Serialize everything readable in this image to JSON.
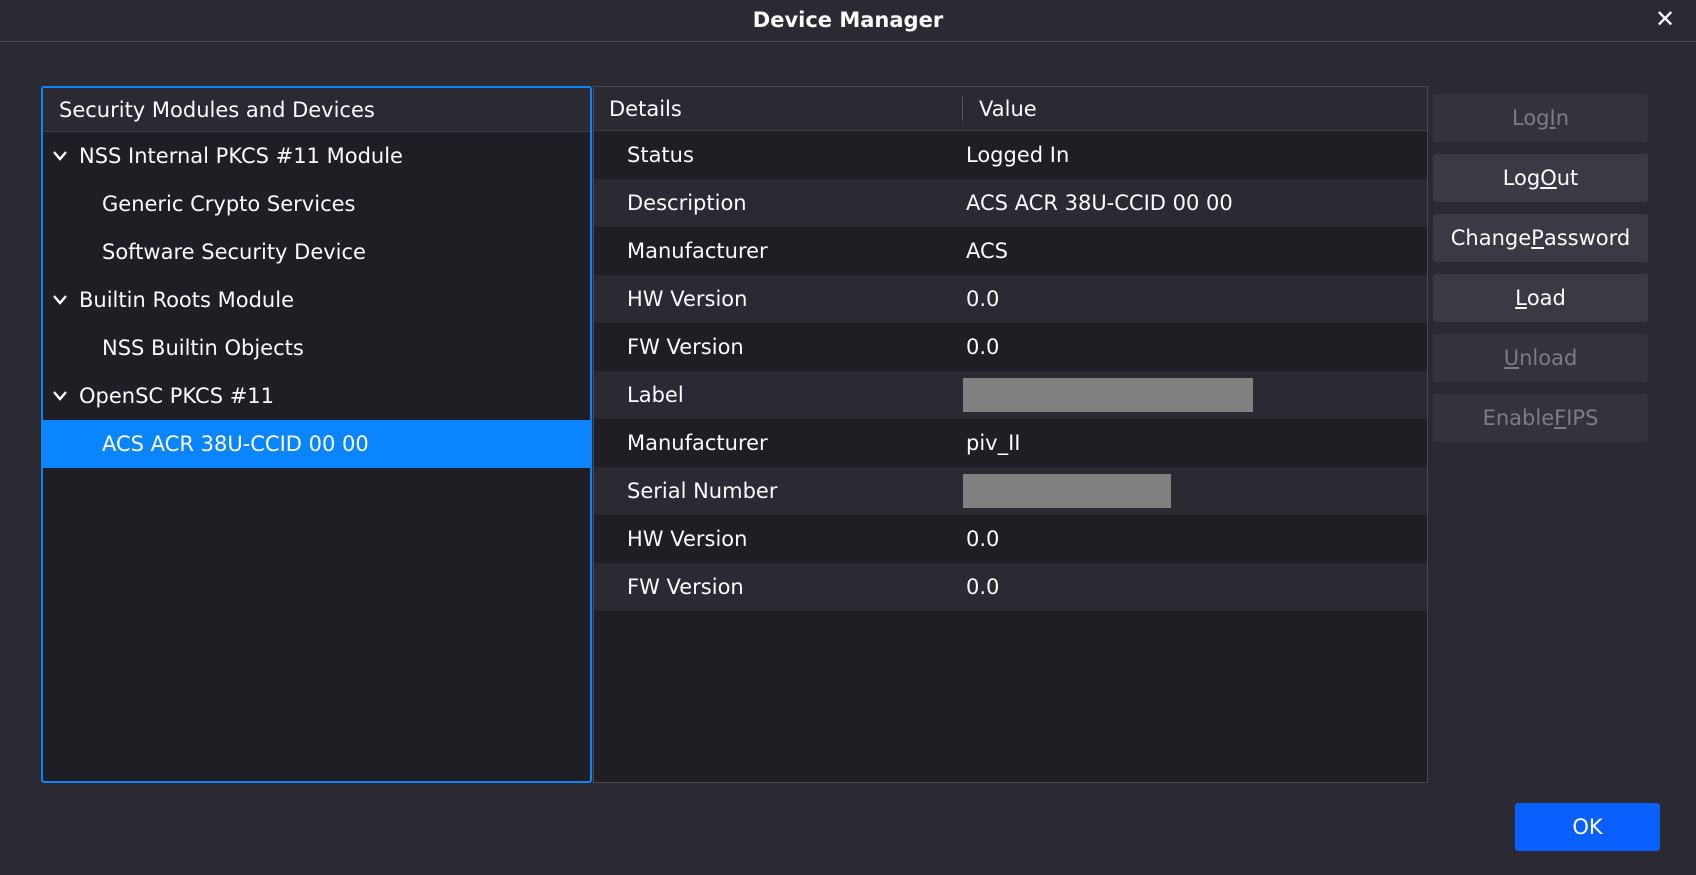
{
  "window": {
    "title": "Device Manager",
    "close_glyph": "✕"
  },
  "tree": {
    "header": "Security Modules and Devices",
    "items": [
      {
        "label": "NSS Internal PKCS #11 Module",
        "level": 0,
        "expanded": true
      },
      {
        "label": "Generic Crypto Services",
        "level": 1
      },
      {
        "label": "Software Security Device",
        "level": 1
      },
      {
        "label": "Builtin Roots Module",
        "level": 0,
        "expanded": true
      },
      {
        "label": "NSS Builtin Objects",
        "level": 1
      },
      {
        "label": "OpenSC PKCS #11",
        "level": 0,
        "expanded": true
      },
      {
        "label": "ACS ACR 38U-CCID 00 00",
        "level": 1,
        "selected": true
      }
    ]
  },
  "details": {
    "columns": {
      "details": "Details",
      "value": "Value"
    },
    "rows": [
      {
        "key": "Status",
        "value": "Logged In"
      },
      {
        "key": "Description",
        "value": "ACS ACR 38U-CCID 00 00"
      },
      {
        "key": "Manufacturer",
        "value": "ACS"
      },
      {
        "key": "HW Version",
        "value": "0.0"
      },
      {
        "key": "FW Version",
        "value": "0.0"
      },
      {
        "key": "Label",
        "value": null
      },
      {
        "key": "Manufacturer",
        "value": "piv_II"
      },
      {
        "key": "Serial Number",
        "value": null
      },
      {
        "key": "HW Version",
        "value": "0.0"
      },
      {
        "key": "FW Version",
        "value": "0.0"
      }
    ]
  },
  "buttons": {
    "log_in": {
      "pre": "Log ",
      "accel": "I",
      "post": "n",
      "enabled": false
    },
    "log_out": {
      "pre": "Log ",
      "accel": "O",
      "post": "ut",
      "enabled": true
    },
    "change_password": {
      "pre": "Change ",
      "accel": "P",
      "post": "assword",
      "enabled": true
    },
    "load": {
      "pre": "",
      "accel": "L",
      "post": "oad",
      "enabled": true
    },
    "unload": {
      "pre": "",
      "accel": "U",
      "post": "nload",
      "enabled": false
    },
    "enable_fips": {
      "pre": "Enable ",
      "accel": "F",
      "post": "IPS",
      "enabled": false
    },
    "ok": "OK"
  },
  "colors": {
    "accent": "#0a84ff",
    "ok_button": "#0a60ff",
    "background": "#2b2a33",
    "pane": "#1f1e25",
    "redaction": "#808080"
  }
}
